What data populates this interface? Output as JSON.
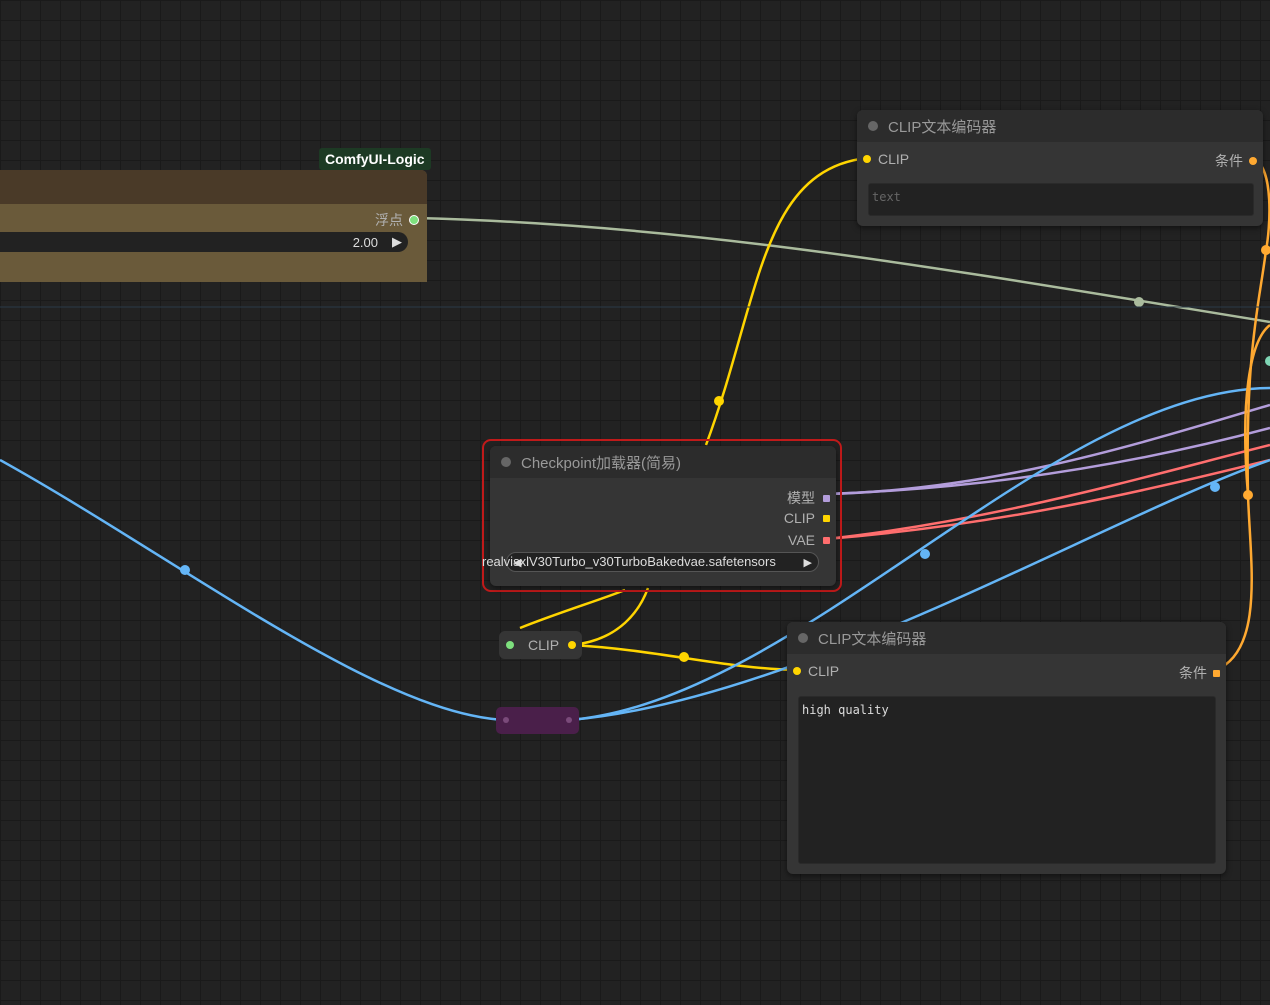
{
  "group": {
    "badge": "ComfyUI-Logic",
    "output_label": "浮点",
    "value": "2.00",
    "arrow": "▶"
  },
  "clip_top": {
    "title": "CLIP文本编码器",
    "input_label": "CLIP",
    "output_label": "条件",
    "placeholder": "text"
  },
  "checkpoint": {
    "title": "Checkpoint加载器(简易)",
    "outputs": [
      "模型",
      "CLIP",
      "VAE"
    ],
    "widget_overlap_text": "realvisxlV30Turbo_v30TurboBakedvae.safetensors",
    "widget_left_arrow": "◀",
    "widget_right_arrow": "▶"
  },
  "reroute": {
    "label": "CLIP"
  },
  "clip_bottom": {
    "title": "CLIP文本编码器",
    "input_label": "CLIP",
    "output_label": "条件",
    "text": "high quality"
  },
  "colors": {
    "model": "#b39ddb",
    "clip": "#ffd500",
    "vae": "#ff6e6e",
    "conditioning": "#ffa931",
    "float": "#aabb9d",
    "latent": "#64b5f6",
    "selected": "#c01a1a"
  }
}
